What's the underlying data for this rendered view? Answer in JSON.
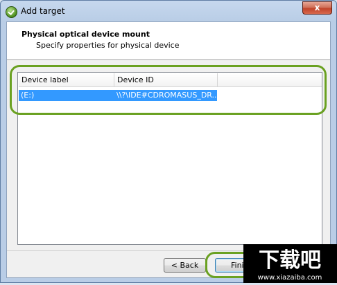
{
  "window": {
    "title": "Add target",
    "close_glyph": "x"
  },
  "header": {
    "title": "Physical optical device mount",
    "subtitle": "Specify properties for physical device"
  },
  "list": {
    "columns": [
      "Device label",
      "Device ID"
    ],
    "rows": [
      {
        "label": "(E:)",
        "device_id": "\\\\?\\IDE#CDROMASUS_DR..."
      }
    ]
  },
  "buttons": {
    "back": "< Back",
    "finish": "Finis"
  },
  "watermark": {
    "text": "下载吧",
    "url": "www.xiazaiba.com"
  },
  "colors": {
    "selection": "#3399ff",
    "highlight_ring": "#6aa121"
  }
}
